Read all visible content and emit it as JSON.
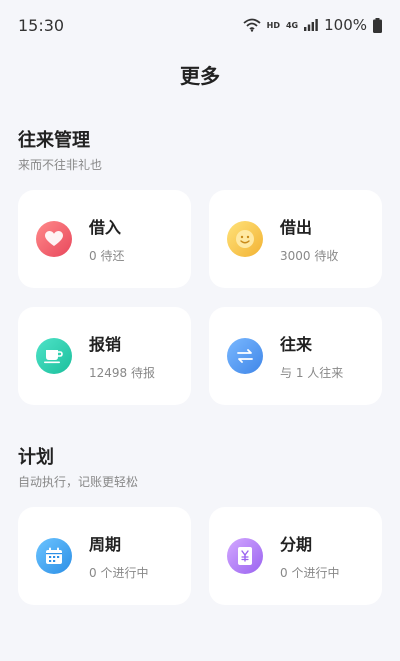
{
  "status_bar": {
    "time": "15:30",
    "hd": "HD",
    "network": "4G",
    "battery": "100%"
  },
  "page": {
    "title": "更多"
  },
  "section_contacts": {
    "title": "往来管理",
    "subtitle": "来而不往非礼也",
    "cards": [
      {
        "title": "借入",
        "subtitle": "0 待还",
        "icon": "heart-icon",
        "color": "#e8475c"
      },
      {
        "title": "借出",
        "subtitle": "3000 待收",
        "icon": "smile-icon",
        "color": "#f2b233"
      },
      {
        "title": "报销",
        "subtitle": "12498 待报",
        "icon": "cup-icon",
        "color": "#1bbf9c"
      },
      {
        "title": "往来",
        "subtitle": "与 1 人往来",
        "icon": "transfer-icon",
        "color": "#3f86e8"
      }
    ]
  },
  "section_plan": {
    "title": "计划",
    "subtitle": "自动执行，记账更轻松",
    "cards": [
      {
        "title": "周期",
        "subtitle": "0 个进行中",
        "icon": "calendar-icon",
        "color": "#2c8fe6"
      },
      {
        "title": "分期",
        "subtitle": "0 个进行中",
        "icon": "ticket-icon",
        "color": "#9a63f0"
      }
    ]
  }
}
